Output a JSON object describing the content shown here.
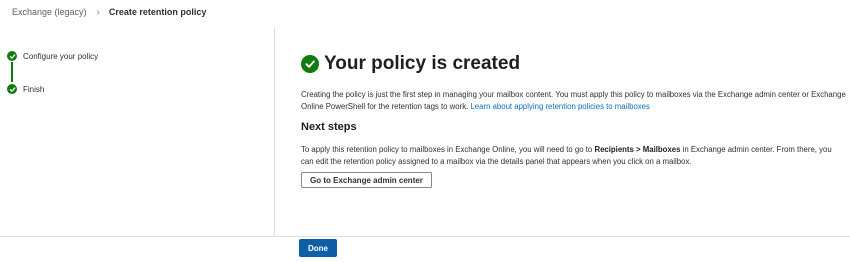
{
  "breadcrumb": {
    "parent": "Exchange (legacy)",
    "separator_icon": "chevron-right-icon",
    "current": "Create retention policy"
  },
  "steps": [
    {
      "label": "Configure your policy",
      "status": "completed"
    },
    {
      "label": "Finish",
      "status": "completed"
    }
  ],
  "main": {
    "title": "Your policy is created",
    "intro_text": "Creating the policy is just the first step in managing your mailbox content. You must apply this policy to mailboxes via the Exchange admin center or Exchange Online PowerShell for the retention tags to work.",
    "intro_link": "Learn about applying retention policies to mailboxes",
    "next_steps_heading": "Next steps",
    "next_steps_before": "To apply this retention policy to mailboxes in Exchange Online, you will need to go to",
    "next_steps_bold": "Recipients > Mailboxes",
    "next_steps_after": "in Exchange admin center. From there, you can edit the retention policy assigned to a mailbox via the details panel that appears when you click on a mailbox.",
    "go_button": "Go to Exchange admin center"
  },
  "footer": {
    "done_button": "Done"
  },
  "colors": {
    "success": "#107c10",
    "primary": "#0f5ea8",
    "link": "#0f6cbd"
  }
}
